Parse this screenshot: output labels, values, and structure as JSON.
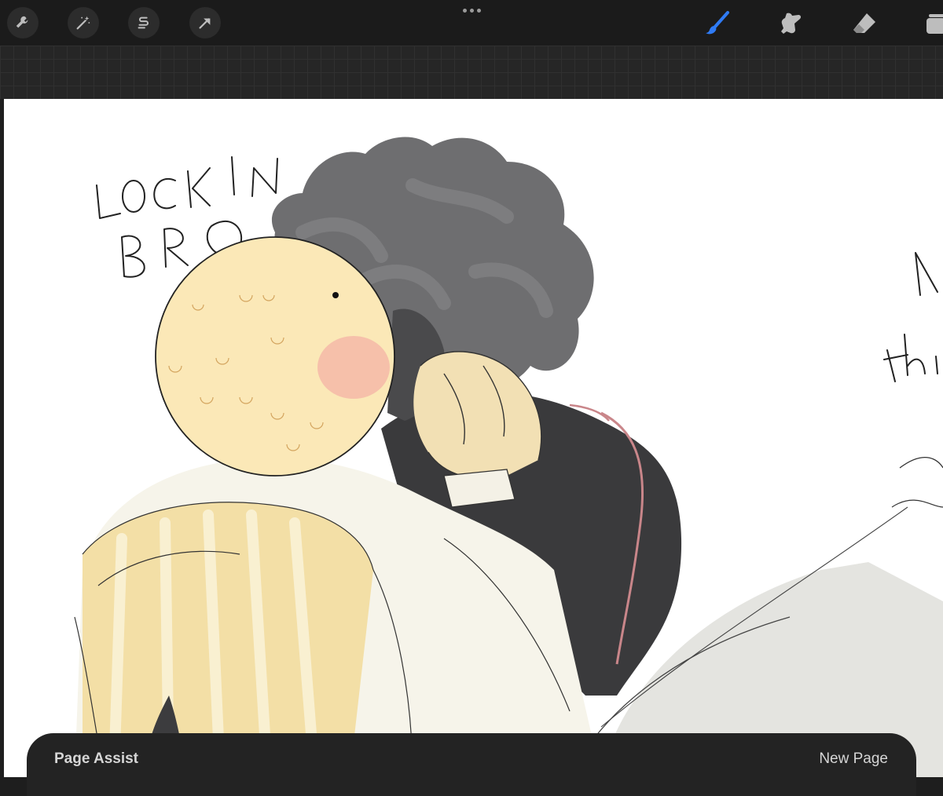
{
  "toolbar": {
    "left_tools": [
      {
        "icon": "wrench-icon",
        "name": "Actions"
      },
      {
        "icon": "magic-wand-icon",
        "name": "Adjustments"
      },
      {
        "icon": "selection-icon",
        "name": "Selection"
      },
      {
        "icon": "arrow-cursor-icon",
        "name": "Transform"
      }
    ],
    "right_tools": [
      {
        "icon": "brush-icon",
        "name": "Brush",
        "active": true
      },
      {
        "icon": "smudge-icon",
        "name": "Smudge"
      },
      {
        "icon": "eraser-icon",
        "name": "Eraser"
      },
      {
        "icon": "layers-icon",
        "name": "Layers"
      }
    ],
    "accent_color": "#2f7bf5"
  },
  "canvas": {
    "handwriting": [
      "LOCKIN",
      "BRO"
    ],
    "partial_handwriting": [
      "A",
      "thi"
    ]
  },
  "page_assist": {
    "title": "Page Assist",
    "new_page_label": "New Page"
  }
}
